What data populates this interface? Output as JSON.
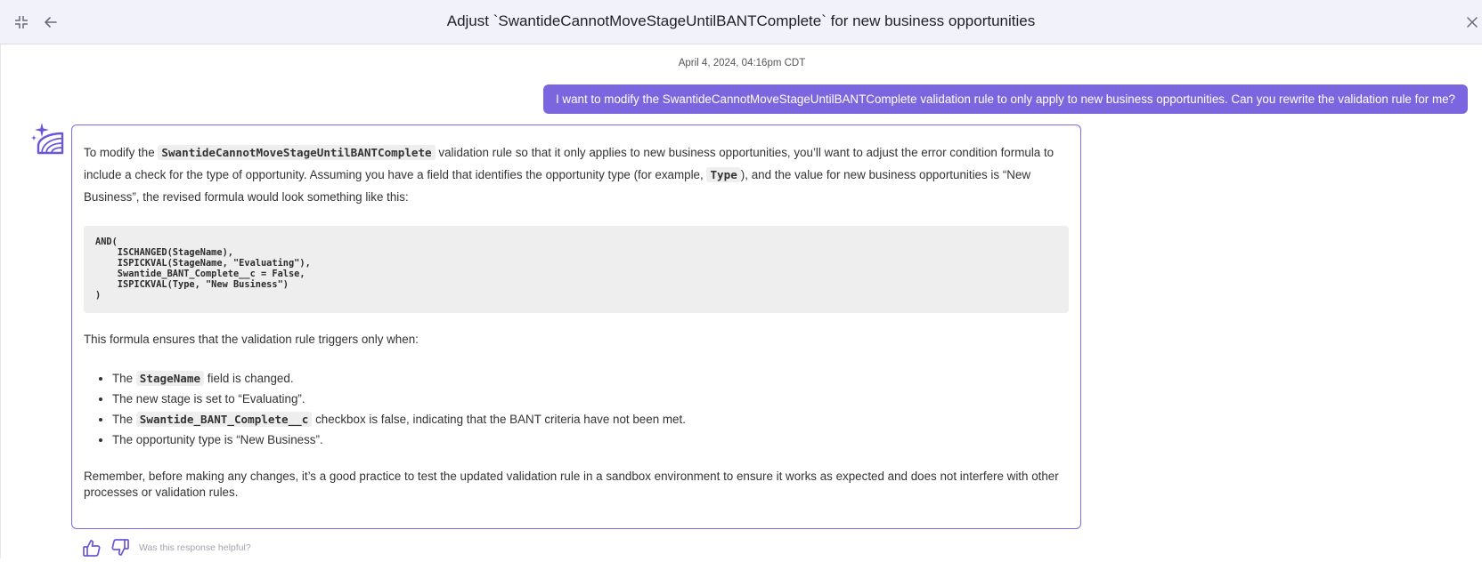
{
  "header": {
    "title": "Adjust `SwantideCannotMoveStageUntilBANTComplete` for new business opportunities"
  },
  "chat": {
    "timestamp": "April 4, 2024, 04:16pm CDT",
    "user_message": "I want to modify the SwantideCannotMoveStageUntilBANTComplete validation rule to only apply to new business opportunities. Can you rewrite the validation rule for me?",
    "response": {
      "p1_a": "To modify the ",
      "p1_code": "SwantideCannotMoveStageUntilBANTComplete",
      "p1_b": " validation rule so that it only applies to new business opportunities, you’ll want to adjust the error condition formula to include a check for the type of opportunity. Assuming you have a field that identifies the opportunity type (for example, ",
      "p1_code2": "Type",
      "p1_c": "), and the value for new business opportunities is “New Business”, the revised formula would look something like this:",
      "code": "AND(\n    ISCHANGED(StageName),\n    ISPICKVAL(StageName, \"Evaluating\"),\n    Swantide_BANT_Complete__c = False,\n    ISPICKVAL(Type, \"New Business\")\n)",
      "p2": "This formula ensures that the validation rule triggers only when:",
      "bullets": {
        "b1_a": "The ",
        "b1_code": "StageName",
        "b1_b": " field is changed.",
        "b2": "The new stage is set to “Evaluating”.",
        "b3_a": "The ",
        "b3_code": "Swantide_BANT_Complete__c",
        "b3_b": " checkbox is false, indicating that the BANT criteria have not been met.",
        "b4": "The opportunity type is “New Business”."
      },
      "p3": "Remember, before making any changes, it’s a good practice to test the updated validation rule in a sandbox environment to ensure it works as expected and does not interfere with other processes or validation rules."
    },
    "feedback_prompt": "Was this response helpful?"
  },
  "icons": {
    "collapse": "collapse-icon",
    "back": "arrow-left-icon",
    "close": "close-icon",
    "avatar": "swantide-logo-icon",
    "like": "thumbs-up-icon",
    "dislike": "thumbs-down-icon"
  },
  "colors": {
    "accent": "#7b66e0",
    "header_bg": "#f2f2fb",
    "code_bg": "#eeeeee"
  }
}
